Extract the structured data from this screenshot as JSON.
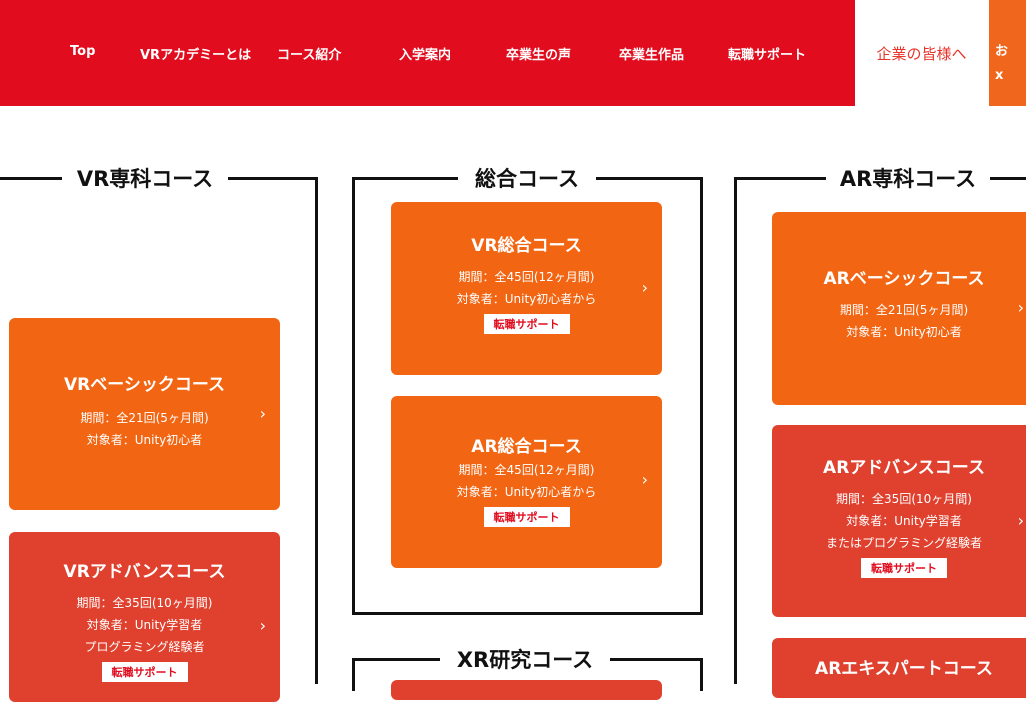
{
  "nav": {
    "items": [
      "Top",
      "VRアカデミーとは",
      "コース紹介",
      "入学案内",
      "卒業生の声",
      "卒業生作品",
      "転職サポート"
    ],
    "corporate_label": "企業の皆様へ",
    "orange_tab_text": [
      "お",
      "x"
    ]
  },
  "groups": {
    "vr_specialist": "VR専科コース",
    "general": "総合コース",
    "ar_specialist": "AR専科コース",
    "xr_research": "XR研究コース"
  },
  "courses": {
    "vr_basic": {
      "title": "VRベーシックコース",
      "period": "期間：全21回(5ヶ月間)",
      "target": "対象者：Unity初心者"
    },
    "vr_advance": {
      "title": "VRアドバンスコース",
      "period": "期間：全35回(10ヶ月間)",
      "target": "対象者：Unity学習者",
      "target2": "プログラミング経験者",
      "badge": "転職サポート"
    },
    "vr_general": {
      "title": "VR総合コース",
      "period": "期間：全45回(12ヶ月間)",
      "target": "対象者：Unity初心者から",
      "badge": "転職サポート"
    },
    "ar_general": {
      "title": "AR総合コース",
      "period": "期間：全45回(12ヶ月間)",
      "target": "対象者：Unity初心者から",
      "badge": "転職サポート"
    },
    "ar_basic": {
      "title": "ARベーシックコース",
      "period": "期間：全21回(5ヶ月間)",
      "target": "対象者：Unity初心者"
    },
    "ar_advance": {
      "title": "ARアドバンスコース",
      "period": "期間：全35回(10ヶ月間)",
      "target": "対象者：Unity学習者",
      "target2": "またはプログラミング経験者",
      "badge": "転職サポート"
    },
    "ar_expert": {
      "title": "ARエキスパートコース"
    }
  },
  "icons": {
    "card_arrow": "chevron-right-icon",
    "arrow_glyph": "›"
  },
  "colors": {
    "nav_red": "#e10d1f",
    "card_orange": "#f26512",
    "card_red": "#e0412e",
    "corporate_text": "#e8352c"
  }
}
